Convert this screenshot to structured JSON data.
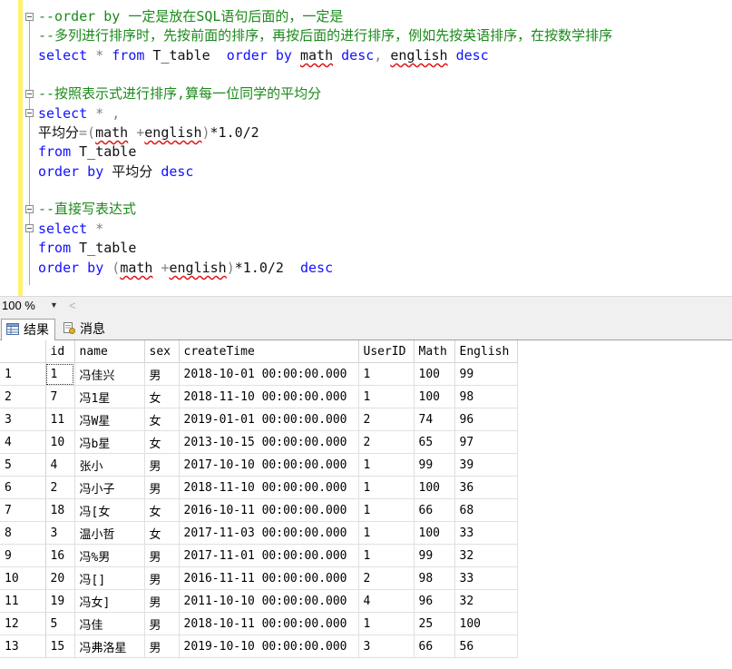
{
  "editor": {
    "line1": "--order by 一定是放在SQL语句后面的，一定是",
    "line2": "--多列进行排序时，先按前面的排序，再按后面的进行排序，例如先按英语排序，在按数学排序",
    "line3": {
      "select": "select",
      "star": " * ",
      "from": "from",
      "table": " T_table  ",
      "orderby": "order by",
      "sp": " ",
      "math": "math",
      "desc1": " desc",
      "comma": ",",
      "sp2": " ",
      "english": "english",
      "desc2": " desc"
    },
    "line5": "--按照表示式进行排序,算每一位同学的平均分",
    "line6": {
      "select": "select",
      "rest": " * ,"
    },
    "line7": {
      "label": "平均分",
      "eq": "=",
      "open": "(",
      "math": "math",
      "plus": " +",
      "english": "english",
      "close": ")",
      "tail": "*1.0/2"
    },
    "line8": {
      "from": "from",
      "table": " T_table"
    },
    "line9": {
      "orderby": "order by",
      "label": " 平均分 ",
      "desc": "desc"
    },
    "line11": "--直接写表达式",
    "line12": {
      "select": "select",
      "rest": " *"
    },
    "line13": {
      "from": "from",
      "table": " T_table"
    },
    "line14": {
      "orderby": "order by",
      "sp": " ",
      "open": "(",
      "math": "math",
      "plus": " +",
      "english": "english",
      "close": ")",
      "tail": "*1.0/2  ",
      "desc": "desc"
    }
  },
  "zoom": {
    "value": "100 %",
    "dropdown_icon": "triangle-down",
    "scroll_icon": "chevron-left"
  },
  "tabs": [
    {
      "label": "结果",
      "icon": "grid-icon"
    },
    {
      "label": "消息",
      "icon": "message-icon"
    }
  ],
  "results": {
    "columns": [
      "id",
      "name",
      "sex",
      "createTime",
      "UserID",
      "Math",
      "English"
    ],
    "rows": [
      [
        "1",
        "1",
        "冯佳兴",
        "男",
        "2018-10-01 00:00:00.000",
        "1",
        "100",
        "99"
      ],
      [
        "2",
        "7",
        "冯1星",
        "女",
        "2018-11-10 00:00:00.000",
        "1",
        "100",
        "98"
      ],
      [
        "3",
        "11",
        "冯W星",
        "女",
        "2019-01-01 00:00:00.000",
        "2",
        "74",
        "96"
      ],
      [
        "4",
        "10",
        "冯b星",
        "女",
        "2013-10-15 00:00:00.000",
        "2",
        "65",
        "97"
      ],
      [
        "5",
        "4",
        "张小",
        "男",
        "2017-10-10 00:00:00.000",
        "1",
        "99",
        "39"
      ],
      [
        "6",
        "2",
        "冯小子",
        "男",
        "2018-11-10 00:00:00.000",
        "1",
        "100",
        "36"
      ],
      [
        "7",
        "18",
        "冯[女",
        "女",
        "2016-10-11 00:00:00.000",
        "1",
        "66",
        "68"
      ],
      [
        "8",
        "3",
        "温小哲",
        "女",
        "2017-11-03 00:00:00.000",
        "1",
        "100",
        "33"
      ],
      [
        "9",
        "16",
        "冯%男",
        "男",
        "2017-11-01 00:00:00.000",
        "1",
        "99",
        "32"
      ],
      [
        "10",
        "20",
        "冯[]",
        "男",
        "2016-11-11 00:00:00.000",
        "2",
        "98",
        "33"
      ],
      [
        "11",
        "19",
        "冯女]",
        "男",
        "2011-10-10 00:00:00.000",
        "4",
        "96",
        "32"
      ],
      [
        "12",
        "5",
        "冯佳",
        "男",
        "2018-10-11 00:00:00.000",
        "1",
        "25",
        "100"
      ],
      [
        "13",
        "15",
        "冯弗洛星",
        "男",
        "2019-10-10 00:00:00.000",
        "3",
        "66",
        "56"
      ]
    ]
  }
}
